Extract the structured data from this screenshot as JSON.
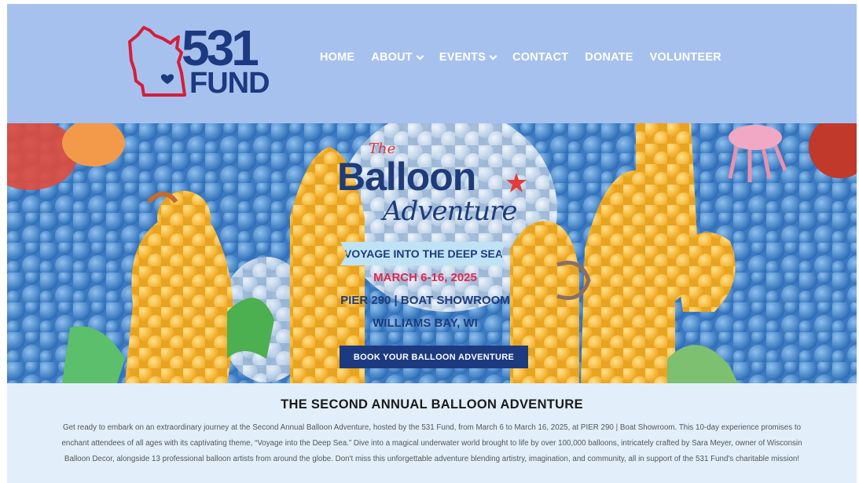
{
  "brand": {
    "logo_number": "531",
    "logo_word": "FUND",
    "colors": {
      "navy": "#1d3a80",
      "red": "#d41e3a",
      "header_bg": "#a7c1ef",
      "section_bg": "#e2effa"
    }
  },
  "nav": {
    "items": [
      {
        "label": "HOME",
        "has_dropdown": false
      },
      {
        "label": "ABOUT",
        "has_dropdown": true
      },
      {
        "label": "EVENTS",
        "has_dropdown": true
      },
      {
        "label": "CONTACT",
        "has_dropdown": false
      },
      {
        "label": "DONATE",
        "has_dropdown": false
      },
      {
        "label": "VOLUNTEER",
        "has_dropdown": false
      }
    ]
  },
  "hero": {
    "title_the": "The",
    "title_main": "Balloon",
    "title_script": "Adventure",
    "theme": "VOYAGE INTO THE DEEP SEA",
    "dates": "MARCH 6-16, 2025",
    "location_line1": "PIER 290 | BOAT SHOWROOM",
    "location_line2": "WILLIAMS BAY, WI",
    "cta_label": "BOOK YOUR BALLOON ADVENTURE"
  },
  "intro": {
    "heading": "THE SECOND ANNUAL BALLOON ADVENTURE",
    "body": "Get ready to embark on an extraordinary journey at the Second Annual Balloon Adventure, hosted by the 531 Fund, from March 6 to March 16, 2025, at PIER 290 | Boat Showroom. This 10-day experience promises to enchant attendees of all ages with its captivating theme, “Voyage into the Deep Sea.” Dive into a magical underwater world brought to life by over 100,000 balloons, intricately crafted by Sara Meyer, owner of Wisconsin Balloon Decor, alongside 13 professional balloon artists from around the globe. Don't miss this unforgettable adventure blending artistry, imagination, and community, all in support of the 531 Fund's charitable mission!"
  }
}
